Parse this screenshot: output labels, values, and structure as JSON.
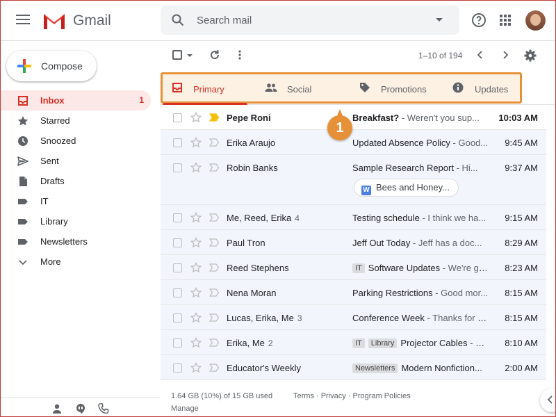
{
  "header": {
    "brand": "Gmail",
    "search_placeholder": "Search mail"
  },
  "compose_label": "Compose",
  "nav": {
    "items": [
      {
        "label": "Inbox",
        "count": "1",
        "icon": "inbox-icon"
      },
      {
        "label": "Starred",
        "icon": "star-icon"
      },
      {
        "label": "Snoozed",
        "icon": "clock-icon"
      },
      {
        "label": "Sent",
        "icon": "send-icon"
      },
      {
        "label": "Drafts",
        "icon": "draft-icon"
      },
      {
        "label": "IT",
        "icon": "label-icon"
      },
      {
        "label": "Library",
        "icon": "label-icon"
      },
      {
        "label": "Newsletters",
        "icon": "label-icon"
      },
      {
        "label": "More",
        "icon": "chevron-down-icon"
      }
    ]
  },
  "toolbar": {
    "pager": "1–10 of 194"
  },
  "tabs": [
    {
      "label": "Primary",
      "icon": "inbox-icon"
    },
    {
      "label": "Social",
      "icon": "people-icon"
    },
    {
      "label": "Promotions",
      "icon": "tag-icon"
    },
    {
      "label": "Updates",
      "icon": "info-icon"
    }
  ],
  "callout_number": "1",
  "emails": [
    {
      "sender": "Pepe Roni",
      "count": "",
      "labels": [],
      "subject": "Breakfast?",
      "snippet": " - Weren't you sup...",
      "time": "10:03 AM",
      "unread": true,
      "important": true
    },
    {
      "sender": "Erika Araujo",
      "count": "",
      "labels": [],
      "subject": "Updated Absence Policy",
      "snippet": " - Good...",
      "time": "9:45 AM"
    },
    {
      "sender": "Robin Banks",
      "count": "",
      "labels": [],
      "subject": "Sample Research Report",
      "snippet": " - Hi...",
      "time": "9:37 AM",
      "attachment": "Bees and Honey..."
    },
    {
      "sender": "Me, Reed, Erika",
      "count": "4",
      "labels": [],
      "subject": "Testing schedule",
      "snippet": " - I think we ha...",
      "time": "9:15 AM"
    },
    {
      "sender": "Paul Tron",
      "count": "",
      "labels": [],
      "subject": "Jeff Out Today ",
      "snippet": " - Jeff has a doc...",
      "time": "8:29 AM"
    },
    {
      "sender": "Reed Stephens",
      "count": "",
      "labels": [
        "IT"
      ],
      "subject": "Software Updates",
      "snippet": " - We're go...",
      "time": "8:23 AM"
    },
    {
      "sender": "Nena Moran",
      "count": "",
      "labels": [],
      "subject": "Parking Restrictions",
      "snippet": " - Good mor...",
      "time": "8:15 AM"
    },
    {
      "sender": "Lucas, Erika, Me",
      "count": "3",
      "labels": [],
      "subject": "Conference Week",
      "snippet": " - Thanks for le...",
      "time": "8:15 AM"
    },
    {
      "sender": "Erika, Me",
      "count": "2",
      "labels": [
        "IT",
        "Library"
      ],
      "subject": "Projector Cables",
      "snippet": " - M...",
      "time": "8:10 AM"
    },
    {
      "sender": "Educator's Weekly",
      "count": "",
      "labels": [
        "Newsletters"
      ],
      "subject": "Modern Nonfiction...",
      "snippet": "",
      "time": "2:00 AM"
    }
  ],
  "footer": {
    "storage": "1.64 GB (10%) of 15 GB used",
    "manage": "Manage",
    "links": "Terms · Privacy · Program Policies"
  },
  "colors": {
    "accent": "#d93025",
    "callout": "#e69138"
  }
}
